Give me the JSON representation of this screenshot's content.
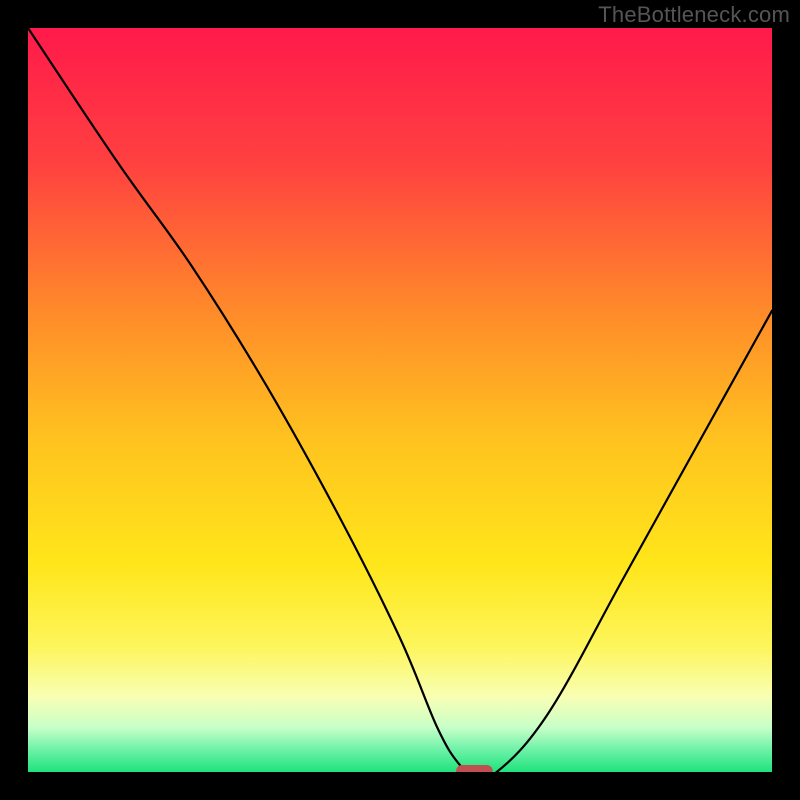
{
  "watermark": {
    "text": "TheBottleneck.com"
  },
  "chart_data": {
    "type": "line",
    "title": "",
    "xlabel": "",
    "ylabel": "",
    "xlim": [
      0,
      100
    ],
    "ylim": [
      0,
      100
    ],
    "legend": false,
    "grid": false,
    "background": {
      "style": "vertical-gradient",
      "stops": [
        {
          "pos": 0.0,
          "color": "#ff1a4b"
        },
        {
          "pos": 0.18,
          "color": "#ff4040"
        },
        {
          "pos": 0.38,
          "color": "#ff8a2a"
        },
        {
          "pos": 0.55,
          "color": "#ffc21f"
        },
        {
          "pos": 0.72,
          "color": "#ffe61a"
        },
        {
          "pos": 0.83,
          "color": "#fdf55a"
        },
        {
          "pos": 0.9,
          "color": "#f8ffb5"
        },
        {
          "pos": 0.94,
          "color": "#c8ffc8"
        },
        {
          "pos": 0.97,
          "color": "#6df2a8"
        },
        {
          "pos": 1.0,
          "color": "#1fe37c"
        }
      ]
    },
    "marker": {
      "x": 60,
      "y": 0,
      "color": "#c05050",
      "rx": 10,
      "ry": 5
    },
    "series": [
      {
        "name": "bottleneck-curve",
        "x": [
          0,
          12,
          22,
          32,
          42,
          50,
          55,
          58,
          60,
          63,
          70,
          80,
          90,
          100
        ],
        "values": [
          100,
          82,
          68,
          52,
          34,
          18,
          6,
          1,
          0,
          0,
          8,
          26,
          44,
          62
        ]
      }
    ]
  }
}
